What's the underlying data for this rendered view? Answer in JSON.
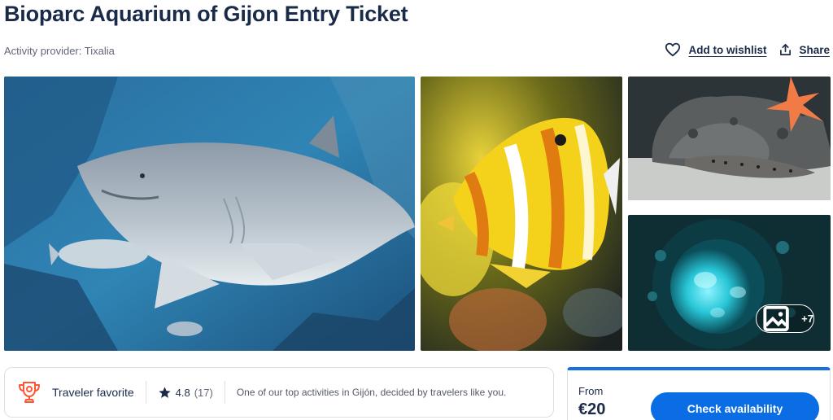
{
  "page": {
    "title": "Bioparc Aquarium of Gijon Entry Ticket",
    "provider_label": "Activity provider: Tixalia"
  },
  "actions": {
    "wishlist_label": "Add to wishlist",
    "share_label": "Share"
  },
  "gallery": {
    "more_photos": "+7"
  },
  "highlight": {
    "badge_label": "Traveler favorite",
    "rating": "4.8",
    "review_count": "(17)",
    "description": "One of our top activities in Gijón, decided by travelers like you."
  },
  "booking": {
    "from_label": "From",
    "price": "€20",
    "cta_label": "Check availability"
  },
  "colors": {
    "text_primary": "#1a2b49",
    "brand_blue": "#0a6de4",
    "accent_orange": "#ff5533"
  },
  "icons": {
    "wishlist": "heart-icon",
    "share": "share-icon",
    "gallery_more": "image-icon",
    "favorite": "trophy-icon",
    "rating": "star-icon"
  }
}
